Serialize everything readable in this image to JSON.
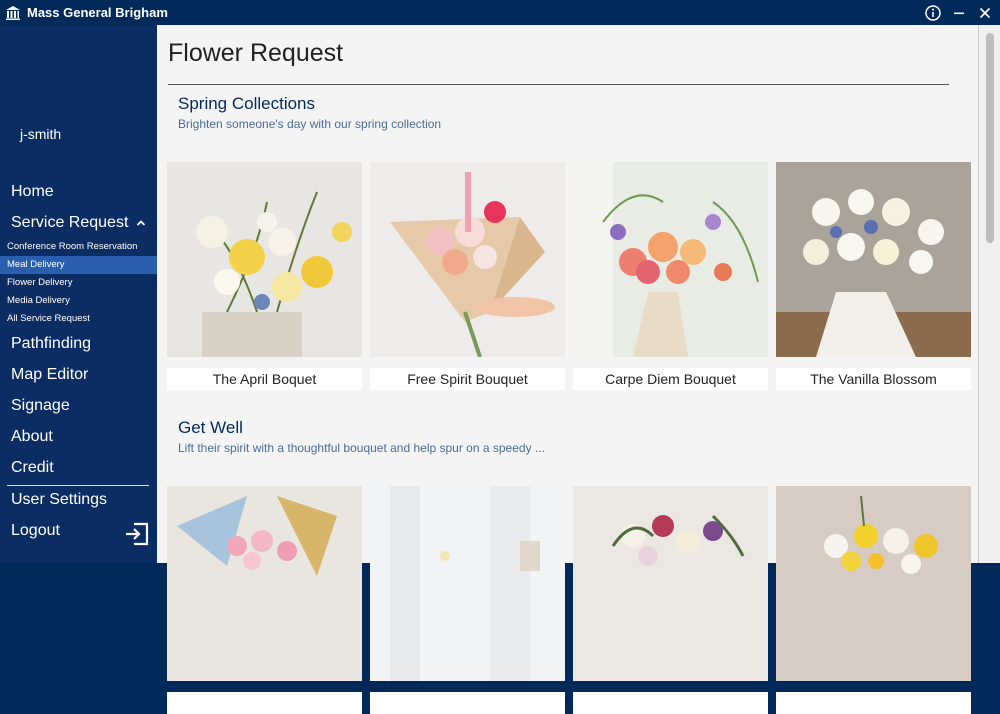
{
  "app": {
    "title": "Mass General Brigham"
  },
  "window_controls": {
    "info_icon": "info-circle-icon",
    "minimize": "–",
    "close": "✕"
  },
  "sidebar": {
    "username": "j-smith",
    "items": {
      "home": "Home",
      "service_request": "Service Request",
      "pathfinding": "Pathfinding",
      "map_editor": "Map Editor",
      "signage": "Signage",
      "about": "About",
      "credit": "Credit",
      "user_settings": "User Settings",
      "logout": "Logout"
    },
    "service_request_expanded_icon": "chevron-up-icon",
    "sub_items": [
      {
        "label": "Conference Room Reservation",
        "active": false
      },
      {
        "label": "Meal Delivery",
        "active": true
      },
      {
        "label": "Flower Delivery",
        "active": false
      },
      {
        "label": "Media Delivery",
        "active": false
      },
      {
        "label": "All Service Request",
        "active": false
      }
    ]
  },
  "main": {
    "title": "Flower Request",
    "sections": [
      {
        "title": "Spring Collections",
        "subtitle": "Brighten someone's day with our spring collection",
        "products": [
          {
            "name": "The April Boquet"
          },
          {
            "name": "Free Spirit Bouquet"
          },
          {
            "name": "Carpe Diem Bouquet"
          },
          {
            "name": "The Vanilla Blossom"
          }
        ]
      },
      {
        "title": "Get Well",
        "subtitle": "Lift their spirit with a thoughtful bouquet and help spur on a speedy ...",
        "products": [
          {
            "name": ""
          },
          {
            "name": ""
          },
          {
            "name": ""
          },
          {
            "name": ""
          }
        ]
      }
    ]
  },
  "colors": {
    "sidebar_bg": "#0b2d63",
    "titlebar_bg": "#012a5a",
    "active_sub_bg": "#2a5fb0",
    "section_title": "#012a5a",
    "section_subtitle": "#4a6d96"
  }
}
